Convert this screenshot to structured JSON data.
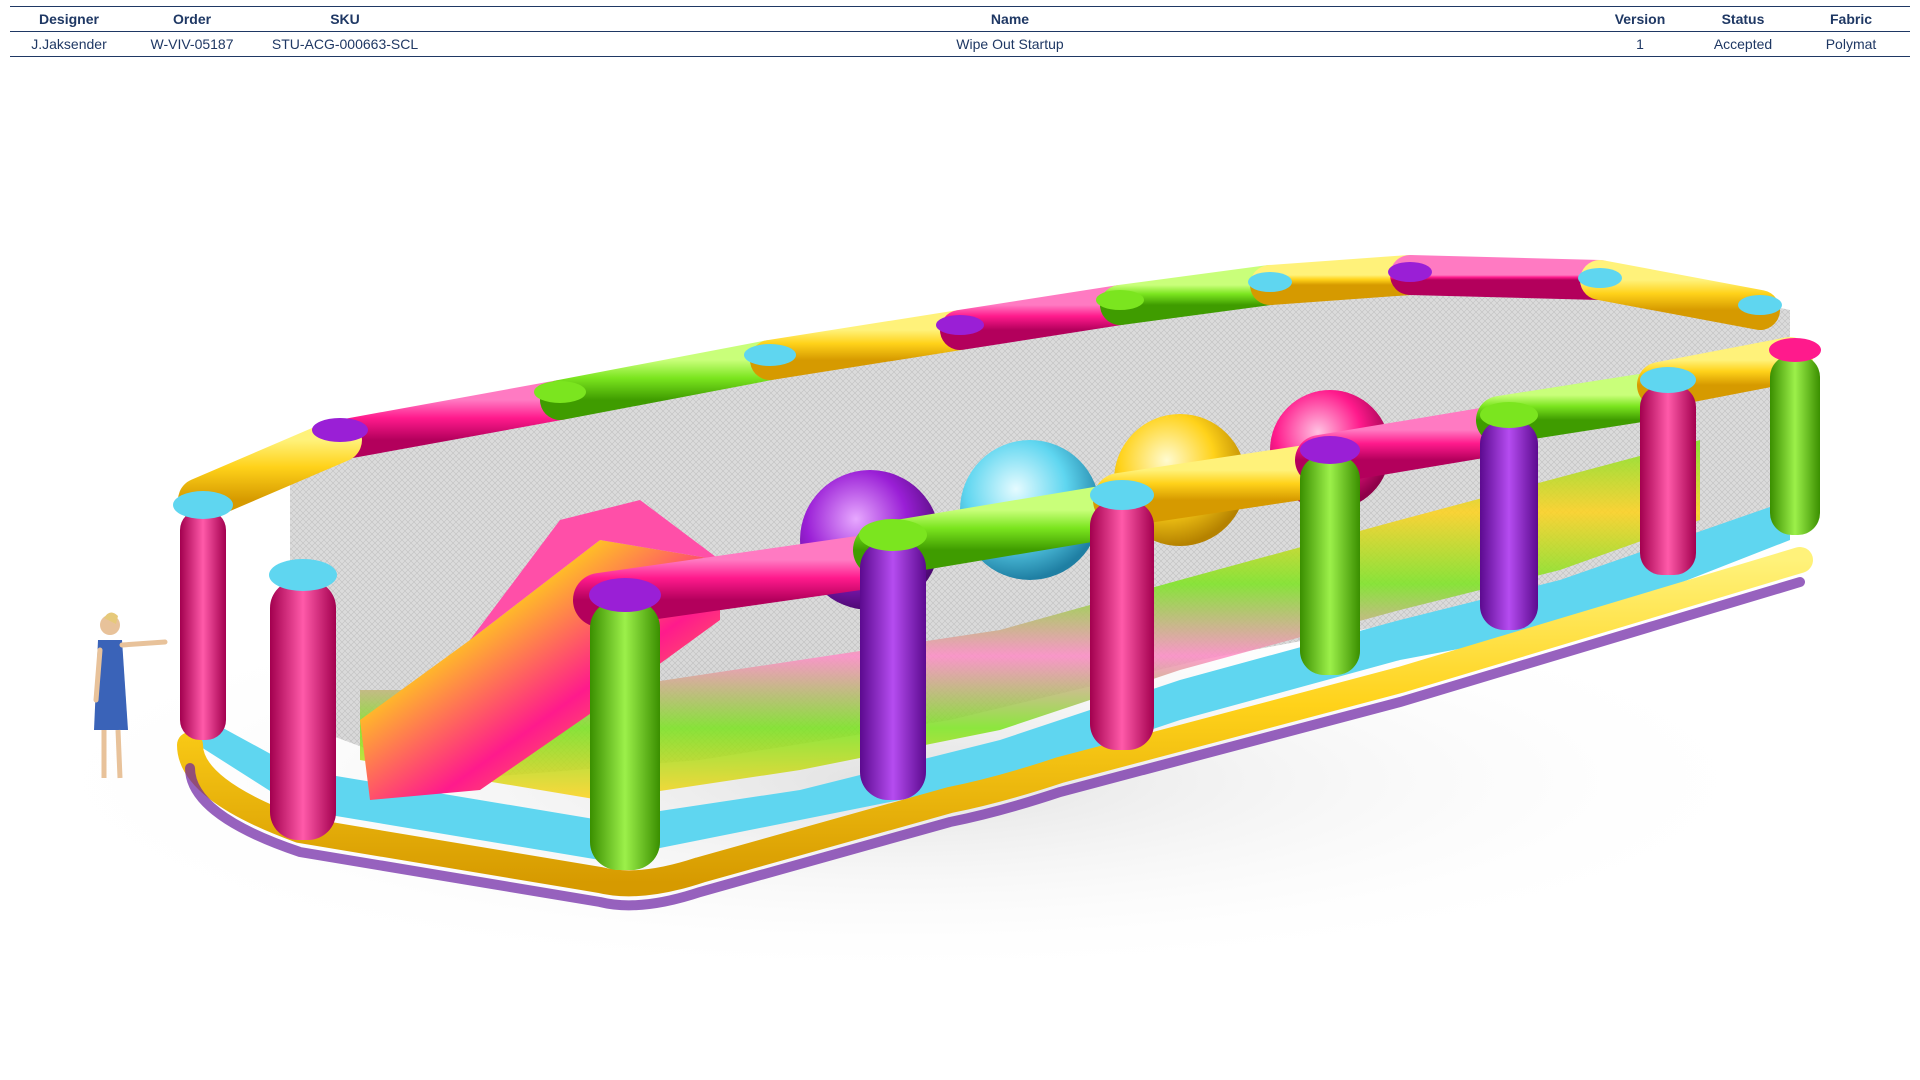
{
  "spec": {
    "headers": {
      "designer": "Designer",
      "order": "Order",
      "sku": "SKU",
      "name": "Name",
      "version": "Version",
      "status": "Status",
      "fabric": "Fabric"
    },
    "row": {
      "designer": "J.Jaksender",
      "order": "W-VIV-05187",
      "sku": "STU-ACG-000663-SCL",
      "name": "Wipe Out Startup",
      "version": "1",
      "status": "Accepted",
      "fabric": "Polymat"
    }
  },
  "colors": {
    "header_text": "#1f3864",
    "pink": "#ff1a8c",
    "yellow": "#ffd21a",
    "green": "#7be51f",
    "cyan": "#5fd6f0",
    "purple": "#9a1fd6",
    "white": "#ffffff"
  }
}
